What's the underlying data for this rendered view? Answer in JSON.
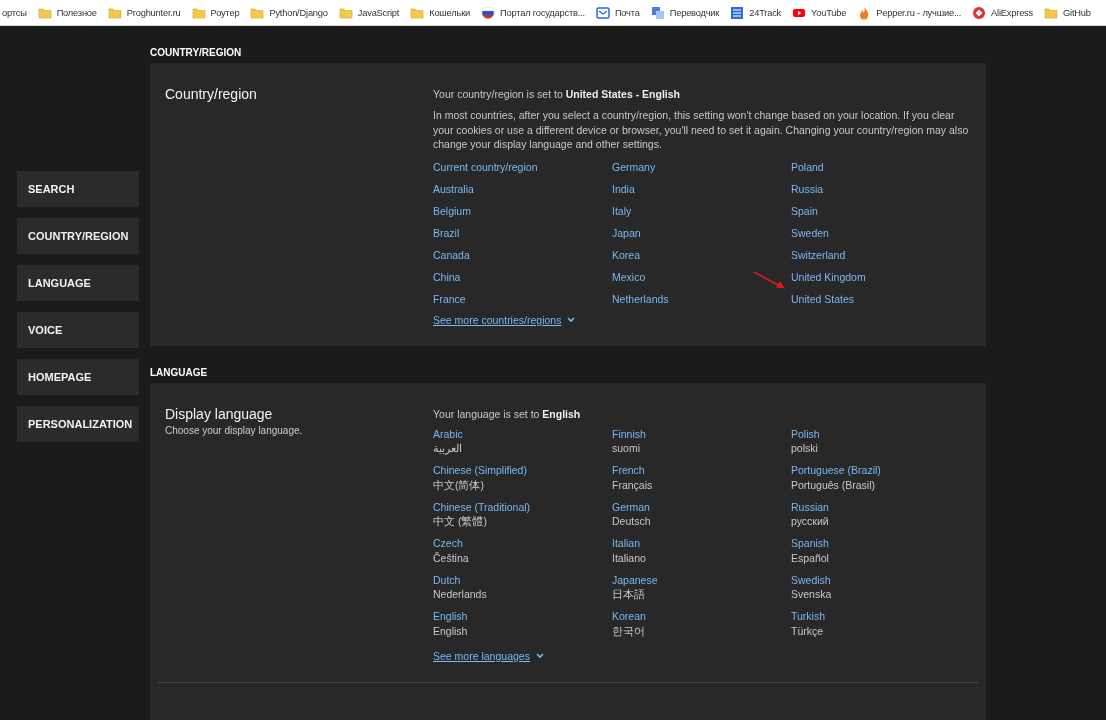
{
  "bookmarks": [
    {
      "label": "ортсы",
      "kind": "none"
    },
    {
      "label": "Полезное",
      "kind": "folder"
    },
    {
      "label": "Proghunter.ru",
      "kind": "folder"
    },
    {
      "label": "Роутер",
      "kind": "folder"
    },
    {
      "label": "Python/Django",
      "kind": "folder"
    },
    {
      "label": "JavaScript",
      "kind": "folder"
    },
    {
      "label": "Кошельки",
      "kind": "folder"
    },
    {
      "label": "Портал государств...",
      "kind": "flag"
    },
    {
      "label": "Почта",
      "kind": "mail"
    },
    {
      "label": "Переводчик",
      "kind": "translate"
    },
    {
      "label": "24Track",
      "kind": "track"
    },
    {
      "label": "YouTube",
      "kind": "video"
    },
    {
      "label": "Pepper.ru - лучшие...",
      "kind": "flame"
    },
    {
      "label": "AliExpress",
      "kind": "shop"
    },
    {
      "label": "GitHub",
      "kind": "folder"
    }
  ],
  "sidebar": {
    "items": [
      {
        "label": "SEARCH"
      },
      {
        "label": "COUNTRY/REGION"
      },
      {
        "label": "LANGUAGE"
      },
      {
        "label": "VOICE"
      },
      {
        "label": "HOMEPAGE"
      },
      {
        "label": "PERSONALIZATION"
      }
    ]
  },
  "country_section": {
    "heading": "COUNTRY/REGION",
    "title": "Country/region",
    "current": "Your country/region is set to **United States - English**",
    "note": "In most countries, after you select a country/region, this setting won't change based on your location. If you clear your cookies or use a different device or browser, you'll need to set it again. Changing your country/region may also change your display language and other settings.",
    "links": [
      "Current country/region",
      "Australia",
      "Belgium",
      "Brazil",
      "Canada",
      "China",
      "France",
      "Germany",
      "India",
      "Italy",
      "Japan",
      "Korea",
      "Mexico",
      "Netherlands",
      "Poland",
      "Russia",
      "Spain",
      "Sweden",
      "Switzerland",
      "United Kingdom",
      "United States"
    ],
    "more": "See more countries/regions"
  },
  "language_section": {
    "heading": "LANGUAGE",
    "title": "Display language",
    "subtitle": "Choose your display language.",
    "current": "Your language is set to **English**",
    "languages": [
      {
        "name": "Arabic",
        "native": "العربية"
      },
      {
        "name": "Chinese (Simplified)",
        "native": "中文(简体)"
      },
      {
        "name": "Chinese (Traditional)",
        "native": "中文 (繁體)"
      },
      {
        "name": "Czech",
        "native": "Čeština"
      },
      {
        "name": "Dutch",
        "native": "Nederlands"
      },
      {
        "name": "English",
        "native": "English"
      },
      {
        "name": "Finnish",
        "native": "suomi"
      },
      {
        "name": "French",
        "native": "Français"
      },
      {
        "name": "German",
        "native": "Deutsch"
      },
      {
        "name": "Italian",
        "native": "Italiano"
      },
      {
        "name": "Japanese",
        "native": "日本語"
      },
      {
        "name": "Korean",
        "native": "한국어"
      },
      {
        "name": "Polish",
        "native": "polski"
      },
      {
        "name": "Portuguese (Brazil)",
        "native": "Português (Brasil)"
      },
      {
        "name": "Russian",
        "native": "русский"
      },
      {
        "name": "Spanish",
        "native": "Español"
      },
      {
        "name": "Swedish",
        "native": "Svenska"
      },
      {
        "name": "Turkish",
        "native": "Türkçe"
      }
    ],
    "more": "See more languages"
  }
}
